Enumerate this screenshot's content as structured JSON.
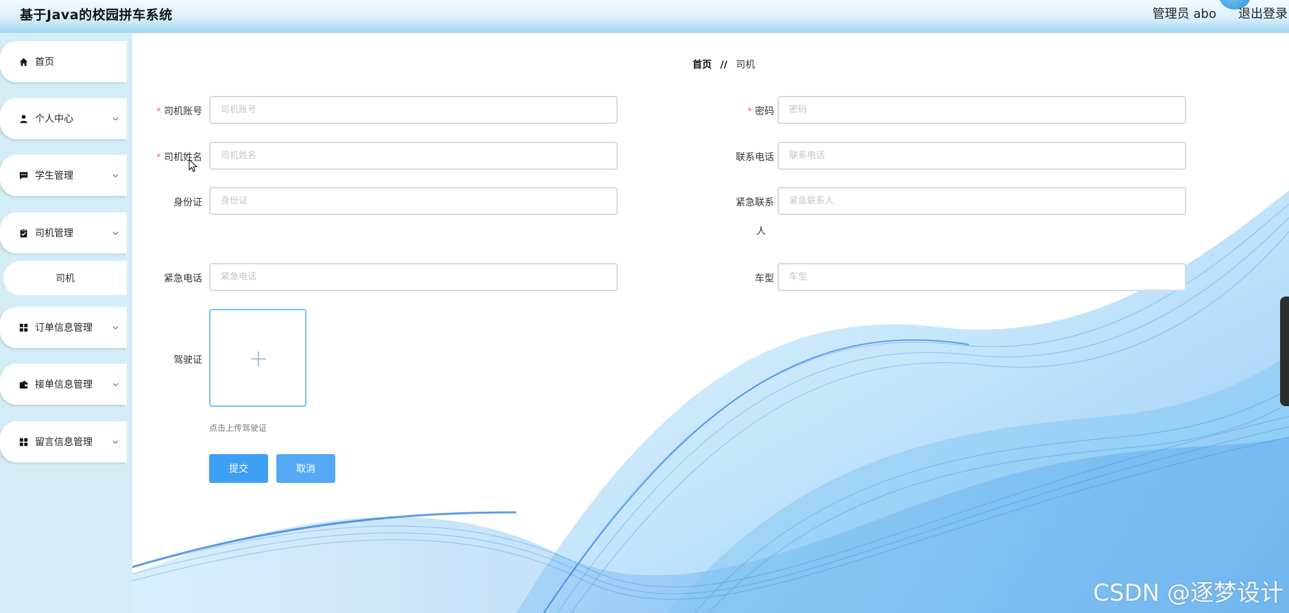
{
  "app": {
    "title": "基于Java的校园拼车系统",
    "user": "管理员 abo",
    "logout": "退出登录"
  },
  "sidebar": {
    "items": [
      {
        "label": "首页",
        "icon": "home-icon"
      },
      {
        "label": "个人中心",
        "icon": "user-icon"
      },
      {
        "label": "学生管理",
        "icon": "chat-icon"
      },
      {
        "label": "司机管理",
        "icon": "clipboard-icon"
      },
      {
        "label": "订单信息管理",
        "icon": "grid-icon"
      },
      {
        "label": "接单信息管理",
        "icon": "wallet-icon"
      },
      {
        "label": "留言信息管理",
        "icon": "grid-icon"
      }
    ],
    "sub_item": "司机"
  },
  "breadcrumb": {
    "home": "首页",
    "separator": "//",
    "current": "司机"
  },
  "form": {
    "account": {
      "label": "司机账号",
      "placeholder": "司机账号",
      "value": ""
    },
    "password": {
      "label": "密码",
      "placeholder": "密码",
      "value": ""
    },
    "name": {
      "label": "司机姓名",
      "placeholder": "司机姓名",
      "value": ""
    },
    "phone": {
      "label": "联系电话",
      "placeholder": "联系电话",
      "value": ""
    },
    "id_card": {
      "label": "身份证",
      "placeholder": "身份证",
      "value": ""
    },
    "emergency_contact": {
      "label_line1": "紧急联系",
      "label_line2": "人",
      "placeholder": "紧急联系人",
      "value": ""
    },
    "emergency_phone": {
      "label": "紧急电话",
      "placeholder": "紧急电话",
      "value": ""
    },
    "car_model": {
      "label": "车型",
      "placeholder": "车型",
      "value": ""
    },
    "license": {
      "label": "驾驶证",
      "tip": "点击上传驾驶证"
    },
    "required_mark": "*",
    "submit": "提交",
    "cancel": "取消"
  },
  "watermark": "CSDN @逐梦设计",
  "colors": {
    "primary": "#3d9ff4",
    "sidebar_bg": "#d2edf6",
    "required": "#f56c6c"
  }
}
